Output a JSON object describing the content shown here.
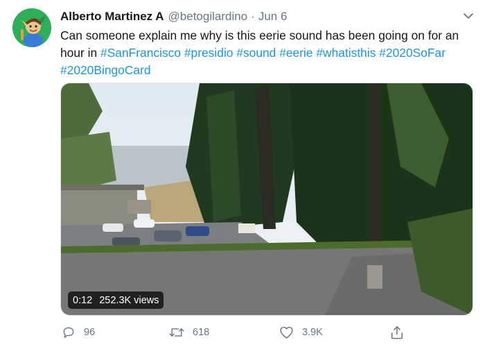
{
  "tweet": {
    "author": {
      "name": "Alberto Martinez A",
      "handle": "@betogilardino",
      "separator": "·",
      "date": "Jun 6"
    },
    "text_plain": "Can someone explain me why is this eerie sound has been going on for an hour in",
    "hashtags": [
      "#SanFrancisco",
      "#presidio",
      "#sound",
      "#eerie",
      "#whatisthis",
      "#2020SoFar",
      "#2020BingoCard"
    ],
    "media": {
      "type": "video",
      "time": "0:12",
      "views": "252.3K views"
    },
    "actions": {
      "replies": "96",
      "retweets": "618",
      "likes": "3.9K"
    },
    "colors": {
      "link": "#1b95e0",
      "text": "#14171a",
      "secondary": "#657786",
      "avatar_bg": "#2fae5a"
    },
    "icons": {
      "reply": "speech-bubble-icon",
      "retweet": "retweet-arrows-icon",
      "like": "heart-outline-icon",
      "share": "share-upload-icon",
      "menu": "chevron-down-icon"
    }
  }
}
